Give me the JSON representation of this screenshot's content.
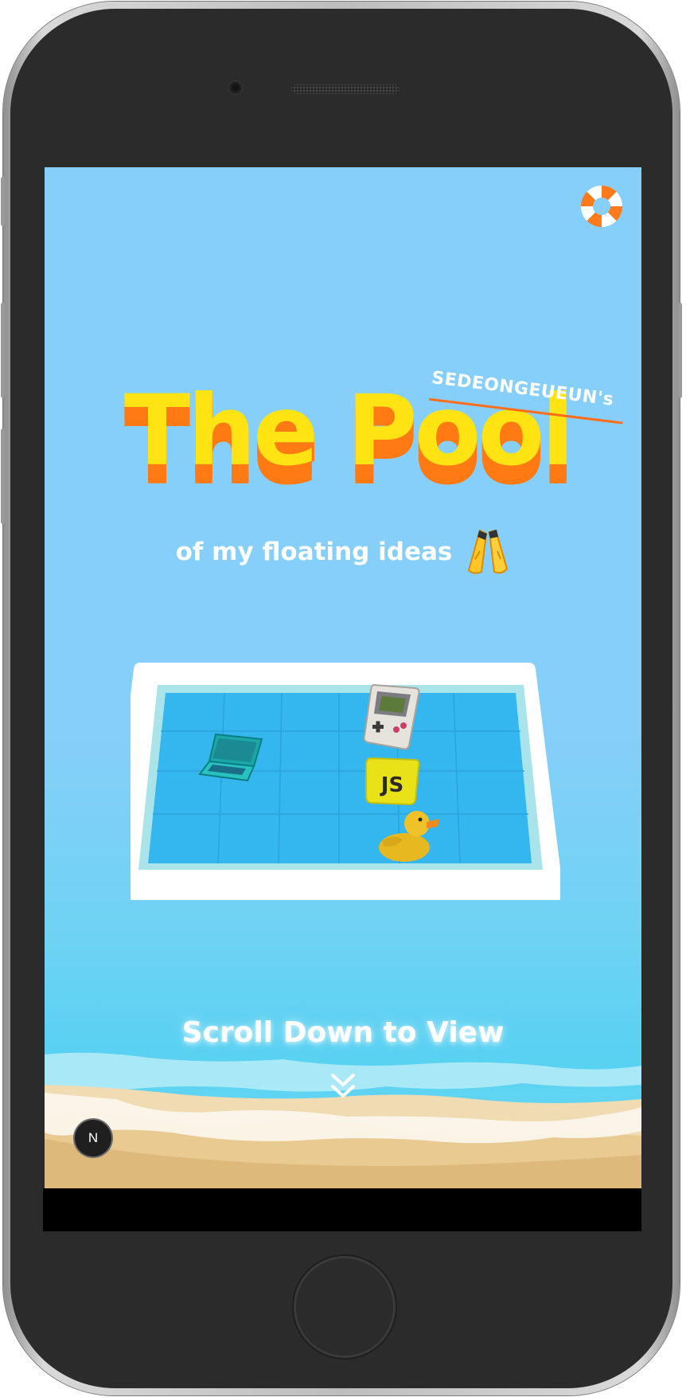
{
  "header": {
    "menu_icon": "lifebuoy-icon"
  },
  "hero": {
    "owner": "SEDEONGEUEUN's",
    "title": "The Pool",
    "subtitle": "of my floating ideas",
    "subtitle_icon": "swim-fins-icon",
    "colors": {
      "title": "#ffe312",
      "title_shadow": "#ff7a12",
      "sky": "#86cffa"
    }
  },
  "pool": {
    "floating_items": [
      {
        "name": "laptop",
        "icon": "laptop-icon"
      },
      {
        "name": "game console",
        "icon": "gameboy-icon"
      },
      {
        "name": "javascript badge",
        "icon": "js-icon",
        "label": "JS"
      },
      {
        "name": "rubber duck",
        "icon": "rubber-duck-icon"
      }
    ]
  },
  "cta": {
    "scroll_label": "Scroll Down to View",
    "scroll_icon": "double-chevron-down-icon"
  },
  "dev_badge": {
    "label": "N"
  }
}
